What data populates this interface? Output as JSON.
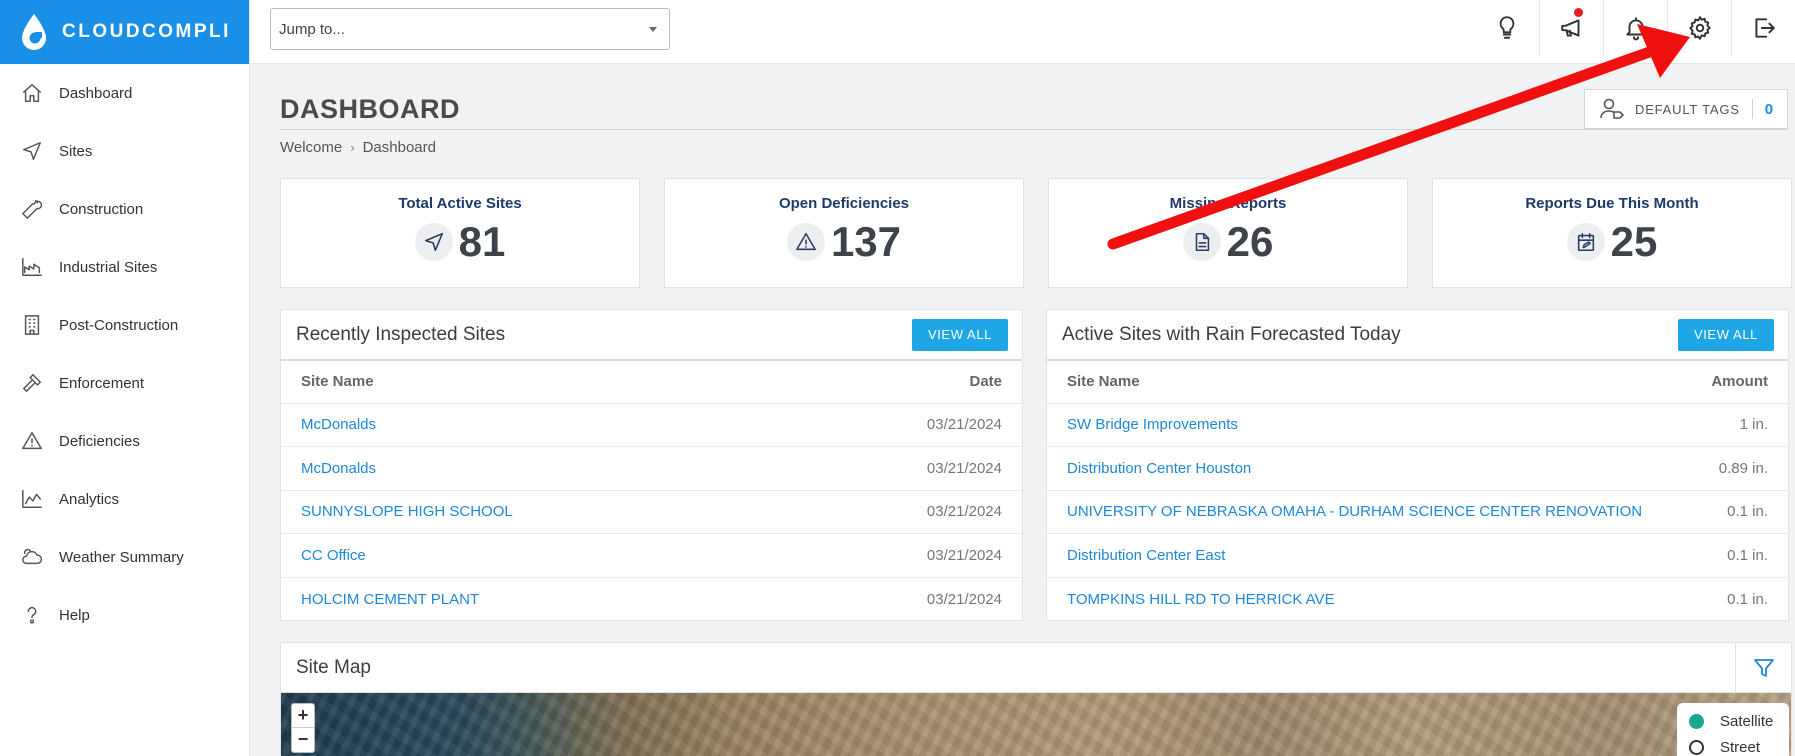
{
  "brand": {
    "name": "CLOUDCOMPLI"
  },
  "sidebar": {
    "items": [
      {
        "label": "Dashboard",
        "icon": "home-icon"
      },
      {
        "label": "Sites",
        "icon": "navigation-arrow-icon"
      },
      {
        "label": "Construction",
        "icon": "wrench-icon"
      },
      {
        "label": "Industrial Sites",
        "icon": "factory-icon"
      },
      {
        "label": "Post-Construction",
        "icon": "building-icon"
      },
      {
        "label": "Enforcement",
        "icon": "gavel-icon"
      },
      {
        "label": "Deficiencies",
        "icon": "warning-icon"
      },
      {
        "label": "Analytics",
        "icon": "area-chart-icon"
      },
      {
        "label": "Weather Summary",
        "icon": "cloud-icon"
      },
      {
        "label": "Help",
        "icon": "help-icon"
      }
    ]
  },
  "topbar": {
    "jump_placeholder": "Jump to...",
    "icons": [
      "lightbulb-icon",
      "megaphone-icon",
      "bell-icon",
      "gear-icon",
      "logout-icon"
    ]
  },
  "page": {
    "title": "DASHBOARD",
    "breadcrumb": [
      "Welcome",
      "Dashboard"
    ],
    "default_tags_label": "DEFAULT TAGS",
    "default_tags_count": "0"
  },
  "stats": [
    {
      "title": "Total Active Sites",
      "value": "81",
      "icon": "navigation-arrow-icon"
    },
    {
      "title": "Open Deficiencies",
      "value": "137",
      "icon": "warning-icon"
    },
    {
      "title": "Missing Reports",
      "value": "26",
      "icon": "document-icon"
    },
    {
      "title": "Reports Due This Month",
      "value": "25",
      "icon": "calendar-edit-icon"
    }
  ],
  "recent": {
    "title": "Recently Inspected Sites",
    "button": "VIEW ALL",
    "columns": [
      "Site Name",
      "Date"
    ],
    "rows": [
      {
        "name": "McDonalds",
        "date": "03/21/2024"
      },
      {
        "name": "McDonalds",
        "date": "03/21/2024"
      },
      {
        "name": "SUNNYSLOPE HIGH SCHOOL",
        "date": "03/21/2024"
      },
      {
        "name": "CC Office",
        "date": "03/21/2024"
      },
      {
        "name": "HOLCIM CEMENT PLANT",
        "date": "03/21/2024"
      }
    ]
  },
  "rain": {
    "title": "Active Sites with Rain Forecasted Today",
    "button": "VIEW ALL",
    "columns": [
      "Site Name",
      "Amount"
    ],
    "rows": [
      {
        "name": "SW Bridge Improvements",
        "amount": "1 in."
      },
      {
        "name": "Distribution Center Houston",
        "amount": "0.89 in."
      },
      {
        "name": "UNIVERSITY OF NEBRASKA OMAHA - DURHAM SCIENCE CENTER RENOVATION",
        "amount": "0.1 in."
      },
      {
        "name": "Distribution Center East",
        "amount": "0.1 in."
      },
      {
        "name": "TOMPKINS HILL RD TO HERRICK AVE",
        "amount": "0.1 in."
      }
    ]
  },
  "map": {
    "title": "Site Map",
    "zoom_in": "+",
    "zoom_out": "−",
    "layers": [
      {
        "label": "Satellite",
        "selected": true
      },
      {
        "label": "Street",
        "selected": false
      }
    ]
  },
  "colors": {
    "brand": "#1a8fe8",
    "link": "#1e88d6",
    "button": "#1ea6e6",
    "annotation_arrow": "#f01010"
  }
}
